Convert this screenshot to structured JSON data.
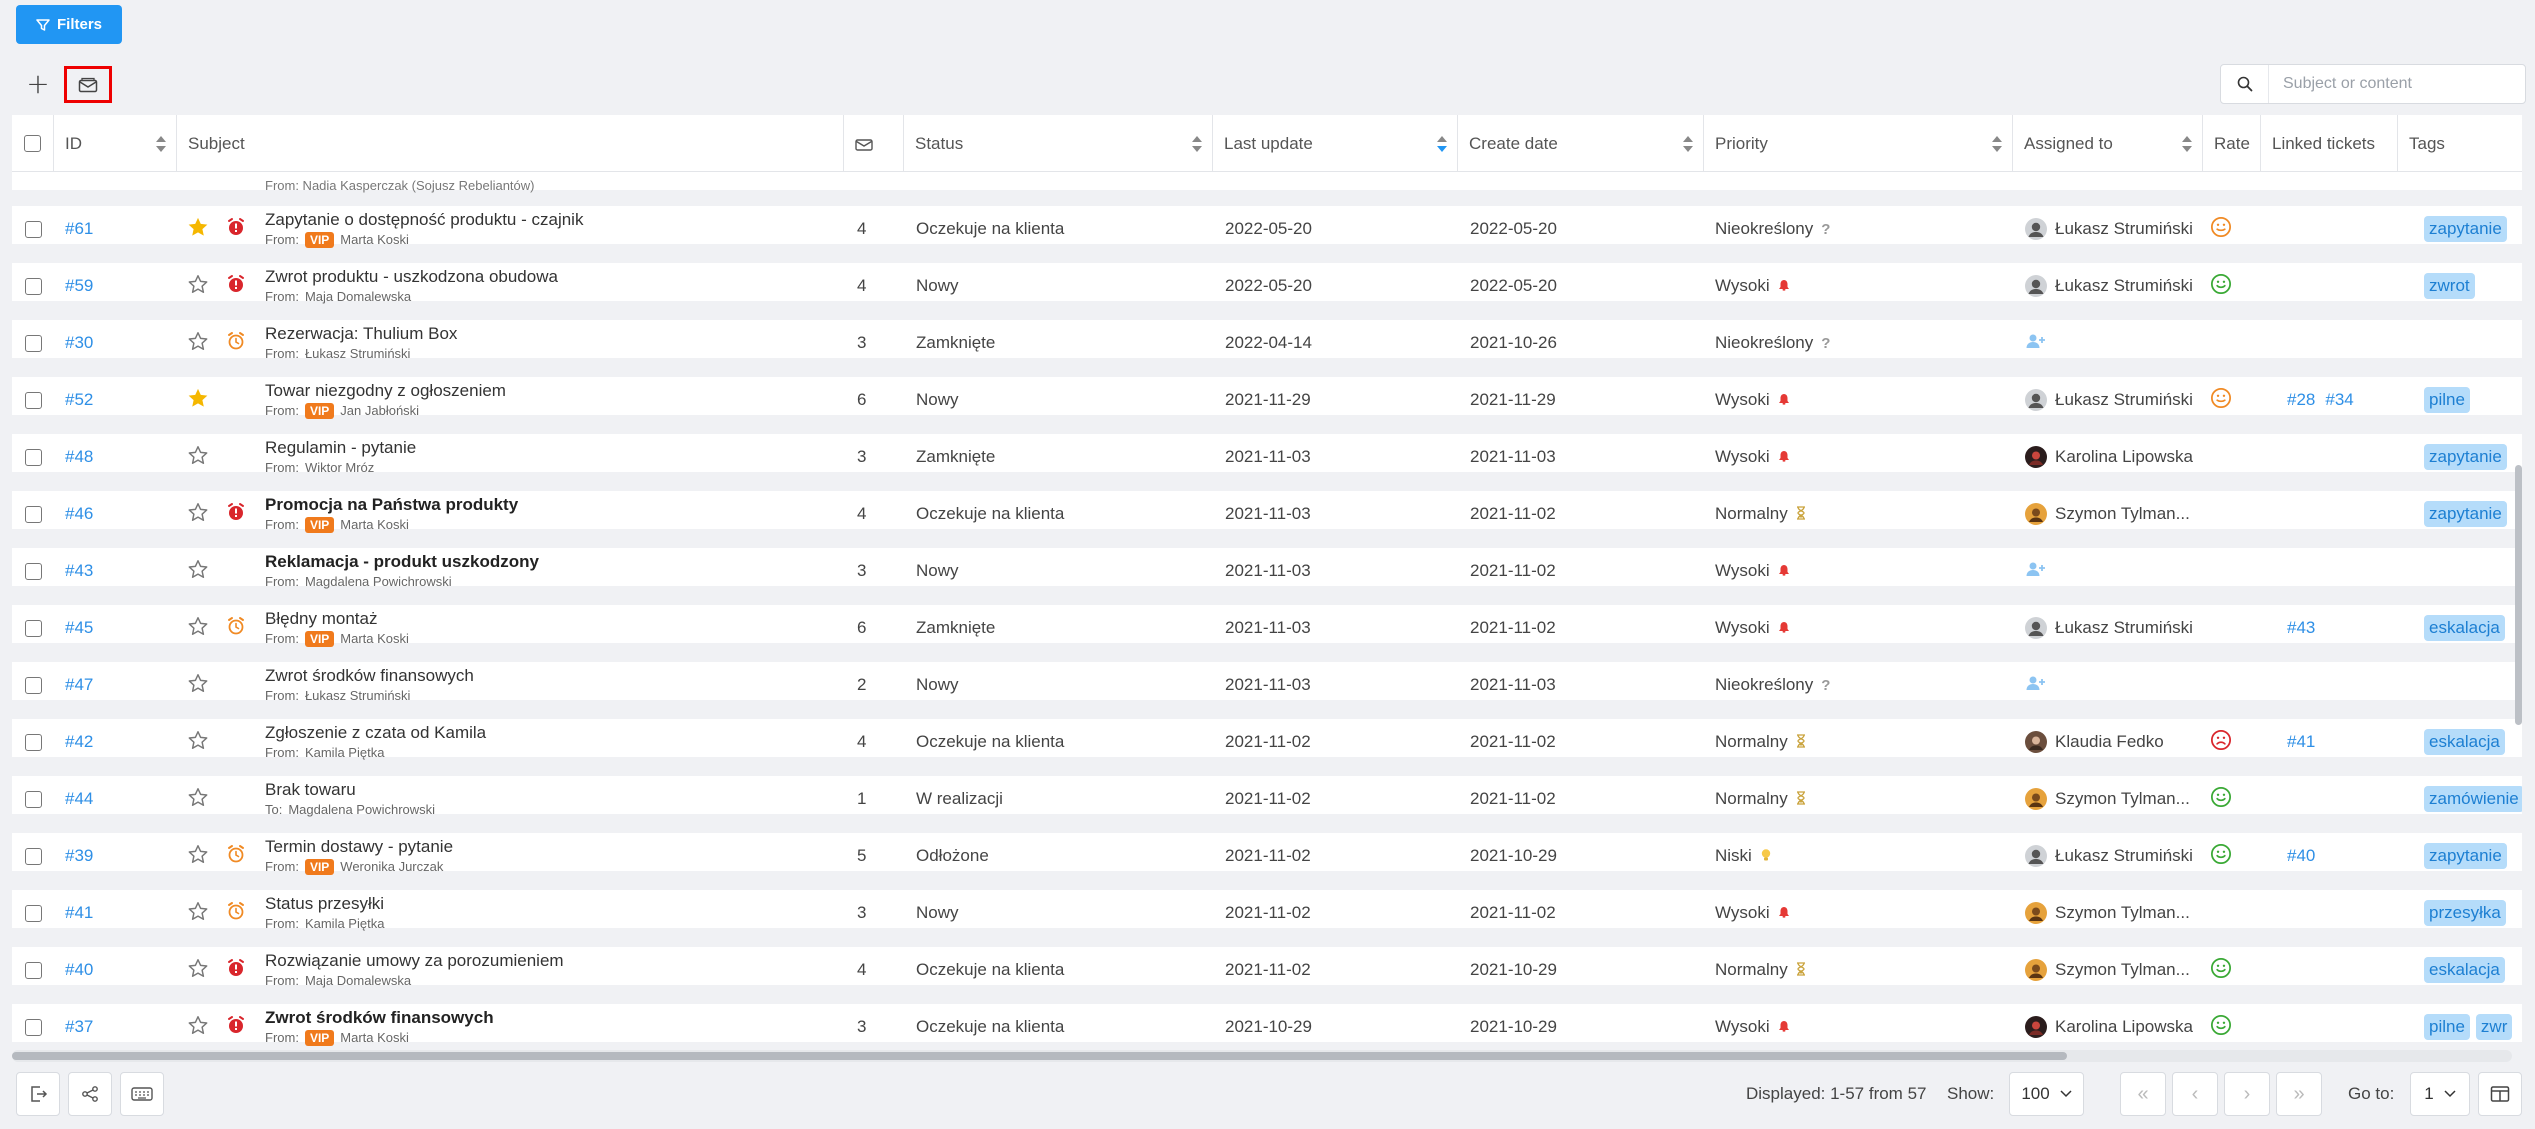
{
  "filters_label": "Filters",
  "search": {
    "placeholder": "Subject or content"
  },
  "columns": {
    "id": "ID",
    "subject": "Subject",
    "status": "Status",
    "last_update": "Last update",
    "create_date": "Create date",
    "priority": "Priority",
    "assigned_to": "Assigned to",
    "rate": "Rate",
    "linked_tickets": "Linked tickets",
    "tags": "Tags"
  },
  "partial_row_from": "From: Nadia Kasperczak (Sojusz Rebeliantów)",
  "rows": [
    {
      "id": "#61",
      "star": true,
      "alarm": "red",
      "subject": "Zapytanie o dostępność produktu - czajnik",
      "bold": false,
      "vip": true,
      "from_prefix": "From:",
      "from": "Marta Koski",
      "count": "4",
      "status": "Oczekuje na klienta",
      "last_update": "2022-05-20",
      "create_date": "2022-05-20",
      "priority": "Nieokreślony",
      "pri": "q",
      "assignee": "Łukasz Strumiński",
      "av": "g",
      "rate": "neutral",
      "linked": [],
      "tags": [
        "zapytanie"
      ]
    },
    {
      "id": "#59",
      "star": false,
      "alarm": "red",
      "subject": "Zwrot produktu - uszkodzona obudowa",
      "bold": false,
      "vip": false,
      "from_prefix": "From:",
      "from": "Maja Domalewska",
      "count": "4",
      "status": "Nowy",
      "last_update": "2022-05-20",
      "create_date": "2022-05-20",
      "priority": "Wysoki",
      "pri": "h",
      "assignee": "Łukasz Strumiński",
      "av": "g",
      "rate": "happy",
      "linked": [],
      "tags": [
        "zwrot"
      ]
    },
    {
      "id": "#30",
      "star": false,
      "alarm": "orange",
      "subject": "Rezerwacja: Thulium Box",
      "bold": false,
      "vip": false,
      "from_prefix": "From:",
      "from": "Łukasz Strumiński",
      "count": "3",
      "status": "Zamknięte",
      "last_update": "2022-04-14",
      "create_date": "2021-10-26",
      "priority": "Nieokreślony",
      "pri": "q",
      "assignee": "",
      "av": "",
      "rate": "",
      "linked": [],
      "tags": []
    },
    {
      "id": "#52",
      "star": true,
      "alarm": "",
      "subject": "Towar niezgodny z ogłoszeniem",
      "bold": false,
      "vip": true,
      "from_prefix": "From:",
      "from": "Jan Jabłoński",
      "count": "6",
      "status": "Nowy",
      "last_update": "2021-11-29",
      "create_date": "2021-11-29",
      "priority": "Wysoki",
      "pri": "h",
      "assignee": "Łukasz Strumiński",
      "av": "g",
      "rate": "neutral",
      "linked": [
        "#28",
        "#34"
      ],
      "tags": [
        "pilne"
      ]
    },
    {
      "id": "#48",
      "star": false,
      "alarm": "",
      "subject": "Regulamin - pytanie",
      "bold": false,
      "vip": false,
      "from_prefix": "From:",
      "from": "Wiktor Mróz",
      "count": "3",
      "status": "Zamknięte",
      "last_update": "2021-11-03",
      "create_date": "2021-11-03",
      "priority": "Wysoki",
      "pri": "h",
      "assignee": "Karolina Lipowska",
      "av": "d",
      "rate": "",
      "linked": [],
      "tags": [
        "zapytanie"
      ]
    },
    {
      "id": "#46",
      "star": false,
      "alarm": "red",
      "subject": "Promocja na Państwa produkty",
      "bold": true,
      "vip": true,
      "from_prefix": "From:",
      "from": "Marta Koski",
      "count": "4",
      "status": "Oczekuje na klienta",
      "last_update": "2021-11-03",
      "create_date": "2021-11-02",
      "priority": "Normalny",
      "pri": "n",
      "assignee": "Szymon Tylman...",
      "av": "y",
      "rate": "",
      "linked": [],
      "tags": [
        "zapytanie"
      ]
    },
    {
      "id": "#43",
      "star": false,
      "alarm": "",
      "subject": "Reklamacja - produkt uszkodzony",
      "bold": true,
      "vip": false,
      "from_prefix": "From:",
      "from": "Magdalena Powichrowski",
      "count": "3",
      "status": "Nowy",
      "last_update": "2021-11-03",
      "create_date": "2021-11-02",
      "priority": "Wysoki",
      "pri": "h",
      "assignee": "",
      "av": "",
      "rate": "",
      "linked": [],
      "tags": []
    },
    {
      "id": "#45",
      "star": false,
      "alarm": "orange",
      "subject": "Błędny montaż",
      "bold": false,
      "vip": true,
      "from_prefix": "From:",
      "from": "Marta Koski",
      "count": "6",
      "status": "Zamknięte",
      "last_update": "2021-11-03",
      "create_date": "2021-11-02",
      "priority": "Wysoki",
      "pri": "h",
      "assignee": "Łukasz Strumiński",
      "av": "g",
      "rate": "",
      "linked": [
        "#43"
      ],
      "tags": [
        "eskalacja"
      ]
    },
    {
      "id": "#47",
      "star": false,
      "alarm": "",
      "subject": "Zwrot środków finansowych",
      "bold": false,
      "vip": false,
      "from_prefix": "From:",
      "from": "Łukasz Strumiński",
      "count": "2",
      "status": "Nowy",
      "last_update": "2021-11-03",
      "create_date": "2021-11-03",
      "priority": "Nieokreślony",
      "pri": "q",
      "assignee": "",
      "av": "",
      "rate": "",
      "linked": [],
      "tags": []
    },
    {
      "id": "#42",
      "star": false,
      "alarm": "",
      "subject": "Zgłoszenie z czata od Kamila",
      "bold": false,
      "vip": false,
      "from_prefix": "From:",
      "from": "Kamila Piętka",
      "count": "4",
      "status": "Oczekuje na klienta",
      "last_update": "2021-11-02",
      "create_date": "2021-11-02",
      "priority": "Normalny",
      "pri": "n",
      "assignee": "Klaudia Fedko",
      "av": "b",
      "rate": "sad",
      "linked": [
        "#41"
      ],
      "tags": [
        "eskalacja"
      ]
    },
    {
      "id": "#44",
      "star": false,
      "alarm": "",
      "subject": "Brak towaru",
      "bold": false,
      "vip": false,
      "from_prefix": "To:",
      "from": "Magdalena Powichrowski",
      "count": "1",
      "status": "W realizacji",
      "last_update": "2021-11-02",
      "create_date": "2021-11-02",
      "priority": "Normalny",
      "pri": "n",
      "assignee": "Szymon Tylman...",
      "av": "y",
      "rate": "happy",
      "linked": [],
      "tags": [
        "zamówienie"
      ]
    },
    {
      "id": "#39",
      "star": false,
      "alarm": "orange",
      "subject": "Termin dostawy - pytanie",
      "bold": false,
      "vip": true,
      "from_prefix": "From:",
      "from": "Weronika Jurczak",
      "count": "5",
      "status": "Odłożone",
      "last_update": "2021-11-02",
      "create_date": "2021-10-29",
      "priority": "Niski",
      "pri": "l",
      "assignee": "Łukasz Strumiński",
      "av": "g",
      "rate": "happy",
      "linked": [
        "#40"
      ],
      "tags": [
        "zapytanie"
      ]
    },
    {
      "id": "#41",
      "star": false,
      "alarm": "orange",
      "subject": "Status przesyłki",
      "bold": false,
      "vip": false,
      "from_prefix": "From:",
      "from": "Kamila Piętka",
      "count": "3",
      "status": "Nowy",
      "last_update": "2021-11-02",
      "create_date": "2021-11-02",
      "priority": "Wysoki",
      "pri": "h",
      "assignee": "Szymon Tylman...",
      "av": "y",
      "rate": "",
      "linked": [],
      "tags": [
        "przesyłka"
      ]
    },
    {
      "id": "#40",
      "star": false,
      "alarm": "red",
      "subject": "Rozwiązanie umowy za porozumieniem",
      "bold": false,
      "vip": false,
      "from_prefix": "From:",
      "from": "Maja Domalewska",
      "count": "4",
      "status": "Oczekuje na klienta",
      "last_update": "2021-11-02",
      "create_date": "2021-10-29",
      "priority": "Normalny",
      "pri": "n",
      "assignee": "Szymon Tylman...",
      "av": "y",
      "rate": "happy",
      "linked": [],
      "tags": [
        "eskalacja"
      ]
    },
    {
      "id": "#37",
      "star": false,
      "alarm": "red",
      "subject": "Zwrot środków finansowych",
      "bold": true,
      "vip": true,
      "from_prefix": "From:",
      "from": "Marta Koski",
      "count": "3",
      "status": "Oczekuje na klienta",
      "last_update": "2021-10-29",
      "create_date": "2021-10-29",
      "priority": "Wysoki",
      "pri": "h",
      "assignee": "Karolina Lipowska",
      "av": "d",
      "rate": "happy",
      "linked": [],
      "tags": [
        "pilne",
        "zwr"
      ]
    }
  ],
  "footer": {
    "displayed": "Displayed: 1-57 from 57",
    "show_label": "Show:",
    "show_value": "100",
    "goto_label": "Go to:",
    "goto_value": "1"
  },
  "colors": {
    "accent": "#2196f3",
    "link": "#2e8fe6",
    "vip": "#f07a1c",
    "star": "#f5b700",
    "alarm_red": "#d9262c",
    "alarm_orange": "#f08a24",
    "rate_happy": "#3aa935",
    "rate_neutral": "#f08a24",
    "rate_sad": "#d9262c"
  }
}
